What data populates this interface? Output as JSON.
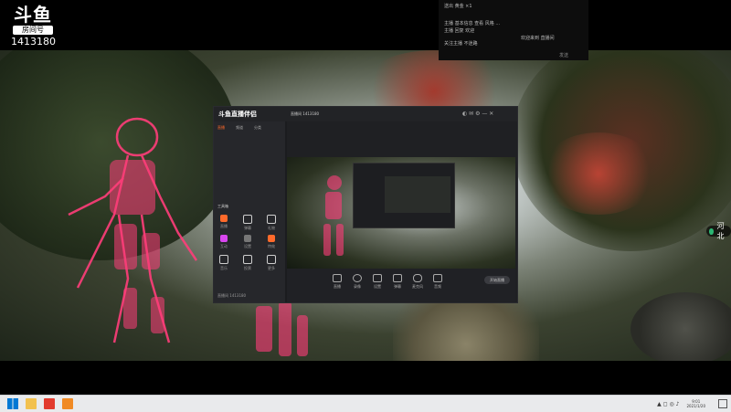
{
  "watermark": {
    "logo": "斗鱼",
    "sub": "房间号",
    "room": "1413180"
  },
  "chat": {
    "lines": [
      "送出 黄金 ×1",
      "主播 基本信息 查看 风格 ...",
      "主播 回复 欢迎",
      "欢迎来到 直播间",
      "关注主播 不迷路"
    ],
    "footer": "发送"
  },
  "region": {
    "label": "河北"
  },
  "app": {
    "logo": "斗鱼直播伴侣",
    "room_title": "直播间 1413180",
    "left_tabs": [
      "直播",
      "频道",
      "分类"
    ],
    "tools_header": "工具箱",
    "tools": [
      {
        "label": "直播",
        "color": "#ff6a2b"
      },
      {
        "label": "弹幕",
        "color": "#cfcfcf"
      },
      {
        "label": "礼物",
        "color": "#cfcfcf"
      },
      {
        "label": "互动",
        "color": "#d946ef"
      },
      {
        "label": "设置",
        "color": "#777777"
      },
      {
        "label": "特效",
        "color": "#ff6a2b"
      },
      {
        "label": "音乐",
        "color": "#cfcfcf"
      },
      {
        "label": "投票",
        "color": "#cfcfcf"
      },
      {
        "label": "更多",
        "color": "#cfcfcf"
      }
    ],
    "status": "直播间 1413180",
    "controls": [
      "直播",
      "录像",
      "设置",
      "弹幕",
      "麦克风",
      "音频"
    ],
    "start_label": "开始直播"
  },
  "taskbar": {
    "time": "9:01",
    "date": "2021/1/20"
  },
  "colors": {
    "pink": "#ff3d7a",
    "accent": "#ff6a2b"
  }
}
